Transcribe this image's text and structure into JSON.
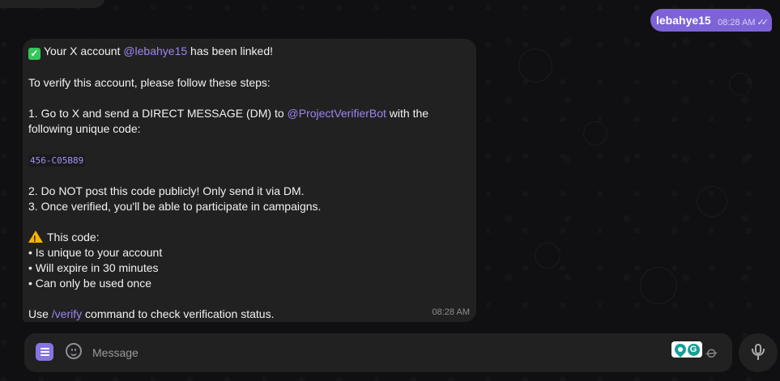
{
  "outgoing_message": {
    "text": "lebahye15",
    "time": "08:28 AM",
    "status_icon": "double-check-icon"
  },
  "incoming_message": {
    "line1_prefix": "Your X account ",
    "line1_mention": "@lebahye15",
    "line1_suffix": " has been linked!",
    "line2": "To verify this account, please follow these steps:",
    "step1_prefix": "1. Go to X and send a DIRECT MESSAGE (DM) to ",
    "step1_mention": "@ProjectVerifierBot",
    "step1_suffix": " with the",
    "step1_cont": "following unique code:",
    "code": "456-C05B89",
    "step2": "2. Do NOT post this code publicly! Only send it via DM.",
    "step3": "3. Once verified, you'll be able to participate in campaigns.",
    "warn_title": "This code:",
    "bullet1": "• Is unique to your account",
    "bullet2": "• Will expire in 30 minutes",
    "bullet3": "• Can only be used once",
    "footer_prefix": "Use ",
    "footer_cmd": "/verify",
    "footer_suffix": " command to check verification status.",
    "time": "08:28 AM",
    "check_emoji": "check-mark-emoji",
    "warning_emoji": "warning-emoji",
    "check_glyph": "✓"
  },
  "composer": {
    "placeholder": "Message",
    "ext_glyph": "G"
  },
  "colors": {
    "accent": "#8774e1",
    "outgoing_bubble": "#7e63d7",
    "incoming_bubble": "#212121",
    "mention": "#9d87f0",
    "background": "#101012"
  }
}
